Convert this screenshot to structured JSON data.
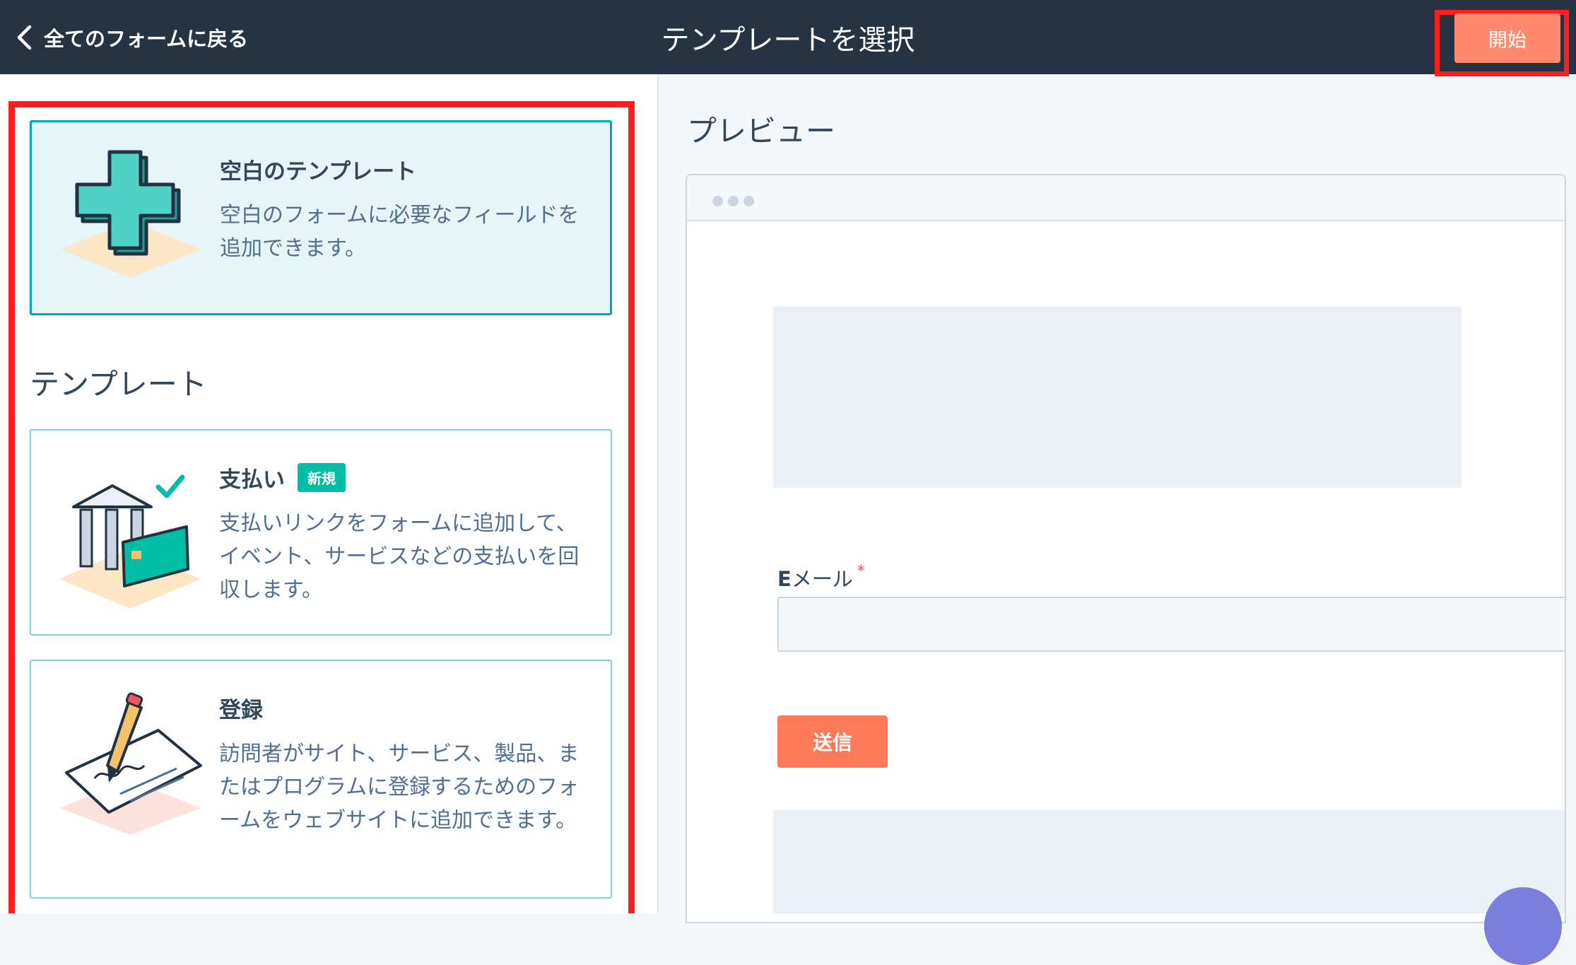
{
  "header": {
    "back_label": "全てのフォームに戻る",
    "title": "テンプレートを選択",
    "start_label": "開始"
  },
  "blank_template": {
    "title": "空白のテンプレート",
    "description": "空白のフォームに必要なフィールドを追加できます。"
  },
  "templates_section": {
    "heading": "テンプレート",
    "items": [
      {
        "title": "支払い",
        "badge": "新規",
        "description": "支払いリンクをフォームに追加して、イベント、サービスなどの支払いを回収します。"
      },
      {
        "title": "登録",
        "description": "訪問者がサイト、サービス、製品、またはプログラムに登録するためのフォームをウェブサイトに追加できます。"
      }
    ]
  },
  "preview": {
    "heading": "プレビュー",
    "email_label_prefix": "E",
    "email_label_rest": "メール",
    "required_mark": "*",
    "submit_label": "送信"
  },
  "colors": {
    "topbar": "#253342",
    "accent": "#ff7a59",
    "highlight_border": "#ff1e1e",
    "selected_border": "#00a4bd",
    "badge": "#00bda5"
  }
}
